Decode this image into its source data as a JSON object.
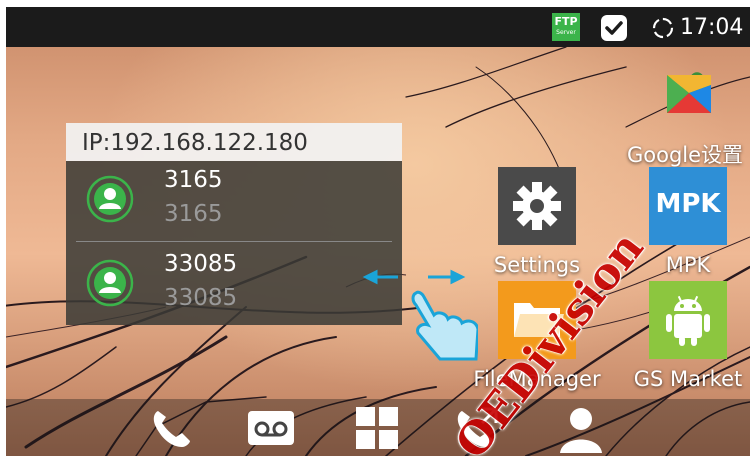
{
  "status_bar": {
    "ftp_badge": {
      "line1": "FTP",
      "line2": "Server"
    },
    "clock": "17:04",
    "icons": [
      "ftp-server-icon",
      "check-notification-icon",
      "sync-icon"
    ]
  },
  "widget": {
    "ip_label": "IP:192.168.122.180",
    "contacts": [
      {
        "name": "3165",
        "number": "3165"
      },
      {
        "name": "33085",
        "number": "33085"
      }
    ]
  },
  "apps": {
    "google_settings": {
      "label": "Google设置"
    },
    "settings": {
      "label": "Settings"
    },
    "mpk": {
      "label": "MPK",
      "tile_text": "MPK"
    },
    "file_manager": {
      "label": "FileManager"
    },
    "gs_market": {
      "label": "GS Market"
    }
  },
  "dock": {
    "icons": [
      "phone-icon",
      "voicemail-icon",
      "apps-grid-icon",
      "call-log-icon",
      "contacts-icon"
    ]
  },
  "watermark": {
    "text": "OEDivision"
  },
  "colors": {
    "status_bar": "#1b1b1b",
    "ftp_green": "#3bb44a",
    "contact_green": "#3bb44a",
    "settings_tile": "#4a4a4a",
    "mpk_tile": "#2e8fd6",
    "file_manager_tile": "#f39a1c",
    "gs_market_tile": "#8cc63f",
    "swipe_blue": "#1aa4d8",
    "watermark_red": "#c60000"
  }
}
